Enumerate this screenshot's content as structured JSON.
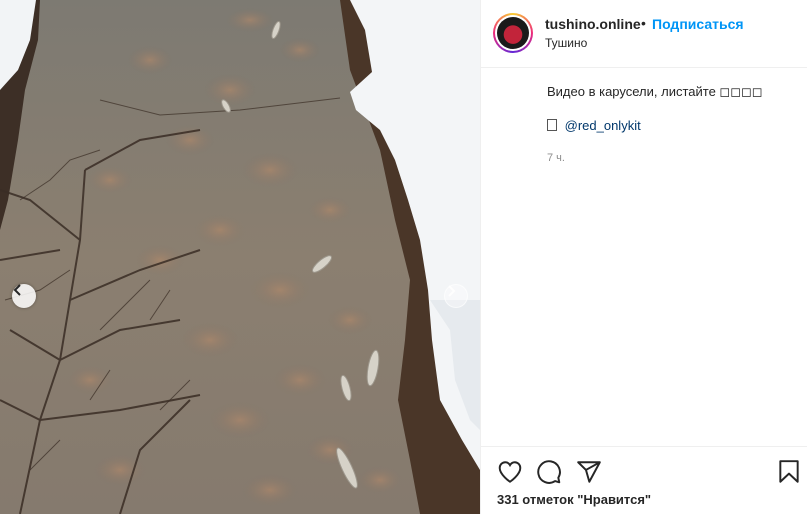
{
  "post": {
    "username": "tushino.online",
    "dot": "•",
    "follow_label": "Подписаться",
    "location": "Тушино",
    "caption_text": "Видео в карусели, листайте ◻◻◻◻",
    "mention": "@red_onlykit",
    "time_ago": "7 ч.",
    "likes_text": "331 отметок \"Нравится\""
  },
  "icons": {
    "prev": "chevron-left-icon",
    "next": "chevron-right-icon",
    "like": "heart-icon",
    "comment": "comment-icon",
    "share": "paper-plane-icon",
    "save": "bookmark-icon"
  },
  "colors": {
    "follow_blue": "#0095f6",
    "mention_blue": "#00376b",
    "muted": "#8e8e8e"
  }
}
